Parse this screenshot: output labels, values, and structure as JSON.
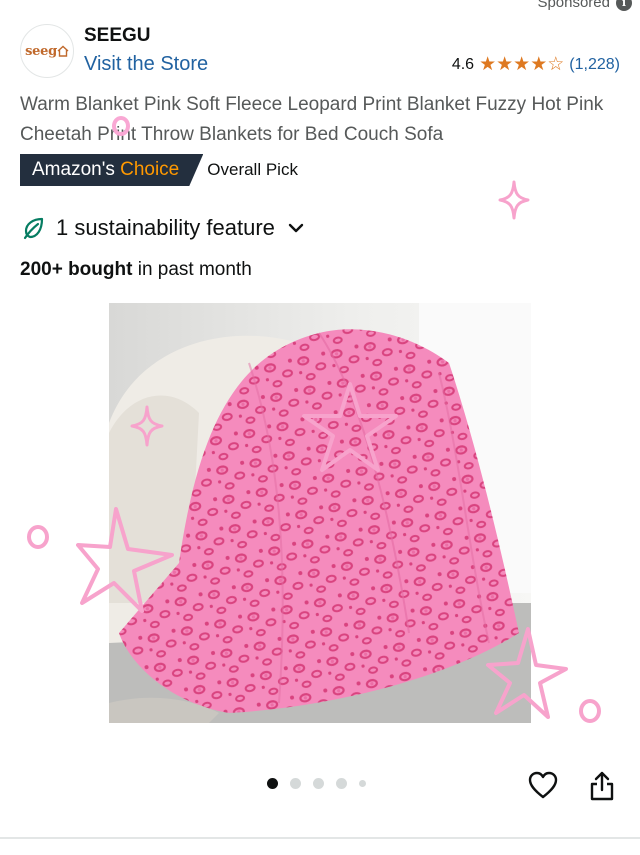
{
  "header": {
    "sponsored_label": "Sponsored",
    "info_icon": "info-icon"
  },
  "brand": {
    "logo_text": "seeg",
    "name": "SEEGU",
    "visit_store": "Visit the Store",
    "rating_value": "4.6",
    "rating_stars": 4.5,
    "rating_count": "(1,228)"
  },
  "product": {
    "title": "Warm Blanket Pink Soft Fleece Leopard Print Blanket Fuzzy Hot Pink Cheetah Print Throw Blankets for Bed Couch Sofa",
    "badge_prefix": "Amazon's",
    "badge_suffix": "Choice",
    "badge_note": "Overall Pick",
    "sustainability": "1 sustainability feature",
    "bought_strong": "200+ bought",
    "bought_rest": " in past month"
  },
  "gallery": {
    "total_images": 5,
    "active_index": 0
  },
  "colors": {
    "link": "#2162a1",
    "star": "#de7921",
    "badge_bg": "#232f3e",
    "badge_accent": "#ff9900",
    "blanket_pink": "#f27ab2",
    "leaf_green": "#067d62"
  }
}
